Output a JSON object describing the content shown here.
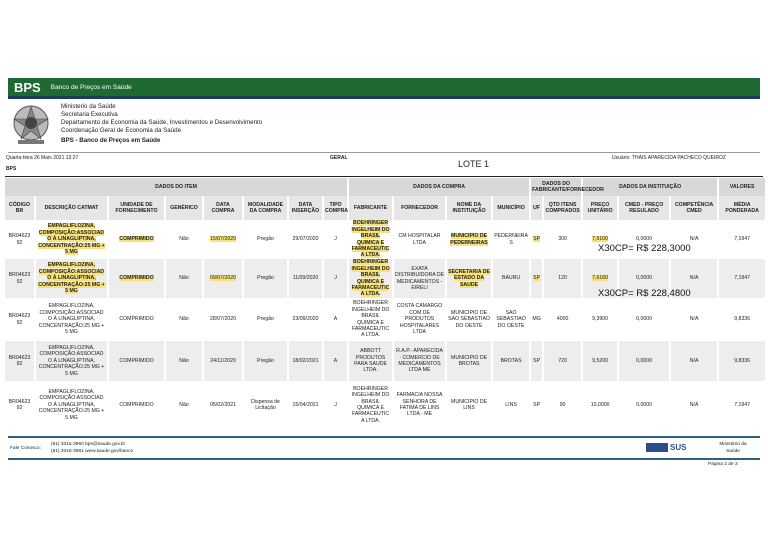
{
  "header": {
    "logo": "BPS",
    "subtitle": "Banco de Preços em Saúde"
  },
  "org": {
    "lines": [
      "Ministerio da Saúde",
      "Secretaria Executiva",
      "Departamento de Economia da Saúde, Investimentos e Desenvolvimento",
      "Coordenação Geral de Economia da Saúde"
    ],
    "title": "BPS - Banco de Preços em Saúde"
  },
  "meta": {
    "date": "Quarta-feira 26 Maio 2021 13:27",
    "scope": "GERAL",
    "user": "Usuário: THAIS APARECIDA PACHECO QUEIROZ",
    "lote": "LOTE 1",
    "bps": "BPS"
  },
  "table": {
    "groups": [
      "DADOS DO ITEM",
      "DADOS DA COMPRA",
      "DADOS DO FABRICANTE/FORNECEDOR",
      "DADOS DA INSTITUIÇÃO",
      "VALORES"
    ],
    "columns": [
      "CÓDIGO BR",
      "DESCRIÇÃO CATMAT",
      "UNIDADE DE FORNECIMENTO",
      "GENÉRICO",
      "DATA COMPRA",
      "MODALIDADE DA COMPRA",
      "DATA INSERÇÃO",
      "TIPO COMPRA",
      "FABRICANTE",
      "FORNECEDOR",
      "NOME DA INSTITUIÇÃO",
      "MUNICÍPIO",
      "UF",
      "QTD ITENS COMPRADOS",
      "PREÇO UNITÁRIO",
      "CMED - PREÇO REGULADO",
      "COMPETÊNCIA CMED",
      "MÉDIA PONDERADA"
    ],
    "rows": [
      [
        "BR04623 92",
        "EMPAGLIFLOZINA, COMPOSIÇÃO:ASSOCIAD O À LINAGLIPTINA, CONCENTRAÇÃO:25 MG + 5 MG",
        "COMPRIMIDO",
        "Não",
        "15/07/2020",
        "Pregão",
        "29/07/2020",
        "J",
        "BOEHRINGER INGELHEIM DO BRASIL QUIMICA E FARMACEUTIC A LTDA.",
        "CM HOSPITALAR LTDA",
        "MUNICIPIO DE PEDERNEIRAS",
        "PEDERNEIRA S",
        "SP",
        "300",
        "7,6100",
        "0,0000",
        "N/A",
        "7,1947"
      ],
      [
        "BR04623 92",
        "EMPAGLIFLOZINA, COMPOSIÇÃO:ASSOCIAD O À LINAGLIPTINA, CONCENTRAÇÃO:25 MG + 5 MG",
        "COMPRIMIDO",
        "Não",
        "09/07/2020",
        "Pregão",
        "11/09/2020",
        "J",
        "BOEHRINGER INGELHEIM DO BRASIL QUIMICA E FARMACEUTIC A LTDA.",
        "EXATA DISTRIBUIDORA DE MEDICAMENTOS - EIRELI",
        "SECRETARIA DE ESTADO DA SAUDE",
        "BAURU",
        "SP",
        "120",
        "7,6160",
        "0,0000",
        "N/A",
        "7,1947"
      ],
      [
        "BR04623 92",
        "EMPAGLIFLOZINA, COMPOSIÇÃO:ASSOCIAD O À LINAGLIPTINA, CONCENTRAÇÃO:25 MG + 5 MG",
        "COMPRIMIDO",
        "Não",
        "28/07/2020",
        "Pregão",
        "23/09/2020",
        "A",
        "BOEHRINGER INGELHEIM DO BRASIL QUIMICA E FARMACEUTIC A LTDA.",
        "COSTA CAMARGO COM DE PRODUTOS HOSPITALARES LTDA",
        "MUNICIPIO DE SAO SEBASTIAO DO OESTE",
        "SAO SEBASTIAO DO OESTE",
        "MG",
        "4000",
        "9,3900",
        "0,0000",
        "N/A",
        "9,8336"
      ],
      [
        "BR04623 92",
        "EMPAGLIFLOZINA, COMPOSIÇÃO:ASSOCIAD O À LINAGLIPTINA, CONCENTRAÇÃO:25 MG + 5 MG",
        "COMPRIMIDO",
        "Não",
        "24/11/2020",
        "Pregão",
        "18/02/2021",
        "A",
        "ABBOTT PRODUTOS PARA SAUDE LTDA.",
        "R.A.P.- APARECIDA - COMERCIO DE MEDICAMENTOS LTDA ME",
        "MUNICIPIO DE BROTAS",
        "BROTAS",
        "SP",
        "720",
        "9,5200",
        "0,0000",
        "N/A",
        "9,8336"
      ],
      [
        "BR04623 92",
        "EMPAGLIFLOZINA, COMPOSIÇÃO:ASSOCIAD O À LINAGLIPTINA, CONCENTRAÇÃO:25 MG + 5 MG",
        "COMPRIMIDO",
        "Não",
        "05/02/2021",
        "Dispensa de Licitação",
        "15/04/2021",
        "J",
        "BOEHRINGER INGELHEIM DO BRASIL QUIMICA E FARMACEUTIC A LTDA.",
        "FARMACIA NOSSA SENHORA DE FATIMA DE LINS LTDA - ME",
        "MUNICIPIO DE LINS",
        "LINS",
        "SP",
        "90",
        "10,0000",
        "0,0000",
        "N/A",
        "7,1947"
      ]
    ]
  },
  "notes": [
    "X30CP= R$ 228,3000",
    "X30CP= R$ 228,4800"
  ],
  "footer": {
    "fale": "Fale Conosco:",
    "contact1": "(61) 3315-3950 bps@saude.gov.br",
    "contact2": "(61) 3315-3961 www.saude.gov/banco",
    "sus": "SUS",
    "ministry": "Ministério da Saúde",
    "page": "Página 2 de 3"
  },
  "colors": {
    "green": "#1f6a33",
    "highlight": "#f6e17a",
    "blue": "#2f5e8a"
  }
}
